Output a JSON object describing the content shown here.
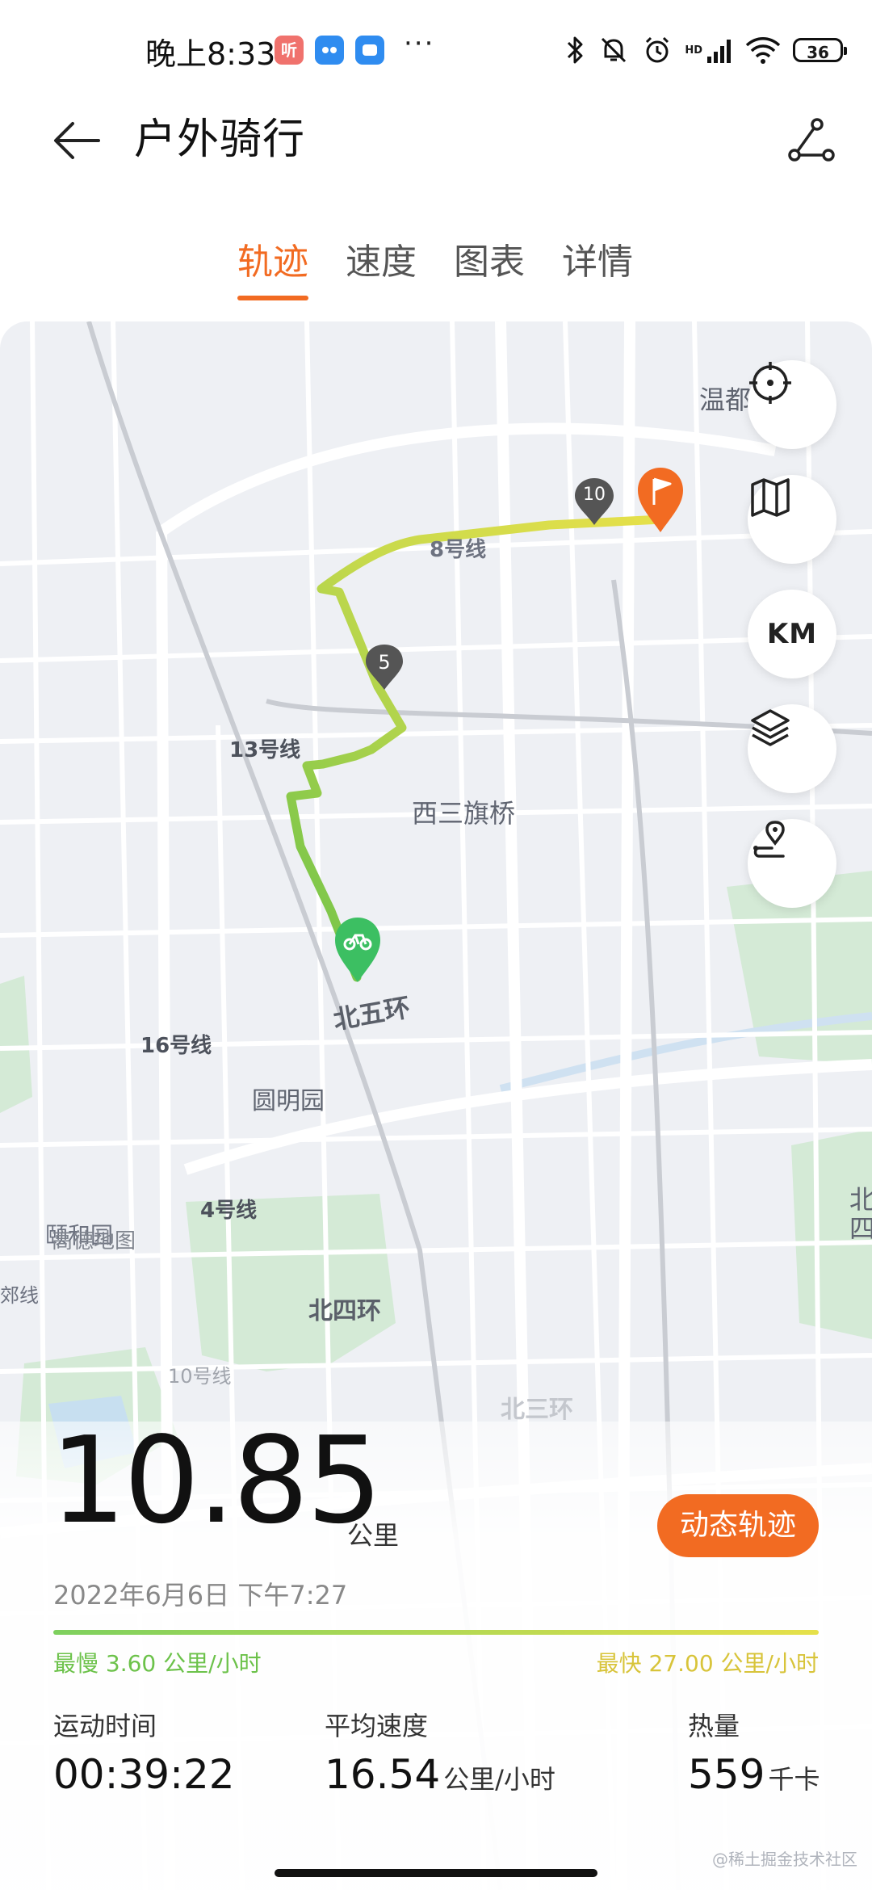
{
  "status_bar": {
    "time": "晚上8:33",
    "app_badges": [
      "听"
    ],
    "more": "···",
    "hd": "HD",
    "battery": "36"
  },
  "header": {
    "title": "户外骑行"
  },
  "tabs": [
    {
      "label": "轨迹",
      "active": true
    },
    {
      "label": "速度",
      "active": false
    },
    {
      "label": "图表",
      "active": false
    },
    {
      "label": "详情",
      "active": false
    }
  ],
  "map": {
    "labels": {
      "wendu": "温都",
      "line8": "8号线",
      "line13": "13号线",
      "xisanqiqiao": "西三旗桥",
      "beiwuhuan": "北五环",
      "line16": "16号线",
      "yuanmingyuan": "圆明园",
      "line4": "4号线",
      "yiheyuan": "颐和园",
      "gaode": "高德地图",
      "beisihuan": "北四环",
      "jiaoxian": "郊线",
      "line10": "10号线",
      "beisanhuan": "北三环",
      "bei": "北",
      "si": "四"
    },
    "markers": {
      "km5": "5",
      "km10": "10"
    },
    "buttons": {
      "km_label": "KM"
    },
    "route_colors": {
      "start": "#6cc24a",
      "end": "#e6e04a"
    }
  },
  "stats": {
    "distance": "10.85",
    "distance_unit": "公里",
    "dynamic_track_button": "动态轨迹",
    "date": "2022年6月6日 下午7:27",
    "slowest": "最慢 3.60 公里/小时",
    "fastest": "最快 27.00 公里/小时",
    "duration_label": "运动时间",
    "duration_value": "00:39:22",
    "avg_speed_label": "平均速度",
    "avg_speed_value": "16.54",
    "avg_speed_unit": "公里/小时",
    "calories_label": "热量",
    "calories_value": "559",
    "calories_unit": "千卡"
  },
  "watermark": "@稀土掘金技术社区"
}
